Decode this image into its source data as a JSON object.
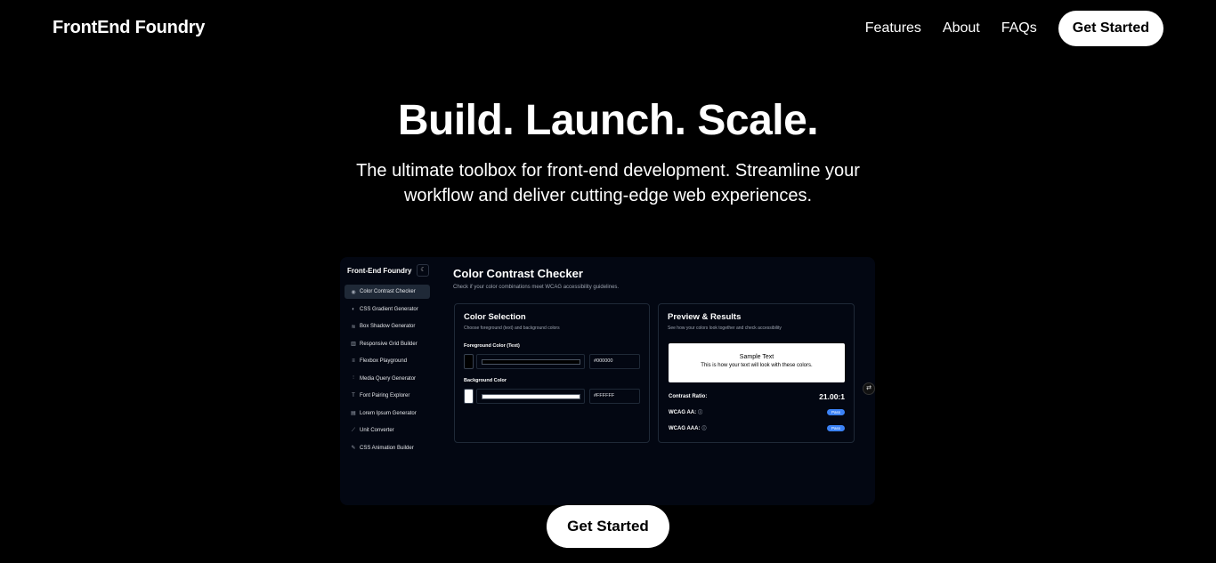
{
  "nav": {
    "brand": "FrontEnd Foundry",
    "links": [
      "Features",
      "About",
      "FAQs"
    ],
    "cta": "Get Started"
  },
  "hero": {
    "title": "Build. Launch. Scale.",
    "subtitle_line1": "The ultimate toolbox for front-end development. Streamline your",
    "subtitle_line2": "workflow and deliver cutting-edge web experiences."
  },
  "preview": {
    "brand": "Front-End Foundry",
    "theme_icon": "moon-icon",
    "sidebar": [
      {
        "label": "Color Contrast Checker",
        "icon": "eye-icon",
        "active": true
      },
      {
        "label": "CSS Gradient Generator",
        "icon": "palette-icon",
        "active": false
      },
      {
        "label": "Box Shadow Generator",
        "icon": "layers-icon",
        "active": false
      },
      {
        "label": "Responsive Grid Builder",
        "icon": "grid-icon",
        "active": false
      },
      {
        "label": "Flexbox Playground",
        "icon": "align-icon",
        "active": false
      },
      {
        "label": "Media Query Generator",
        "icon": "sliders-icon",
        "active": false
      },
      {
        "label": "Font Pairing Explorer",
        "icon": "type-icon",
        "active": false
      },
      {
        "label": "Lorem Ipsum Generator",
        "icon": "document-icon",
        "active": false
      },
      {
        "label": "Unit Converter",
        "icon": "ruler-icon",
        "active": false
      },
      {
        "label": "CSS Animation Builder",
        "icon": "pen-icon",
        "active": false
      }
    ],
    "main": {
      "title": "Color Contrast Checker",
      "description": "Check if your color combinations meet WCAG accessibility guidelines."
    },
    "selection": {
      "title": "Color Selection",
      "description": "Choose foreground (text) and background colors",
      "fg_label": "Foreground Color (Text)",
      "fg_value": "#000000",
      "bg_label": "Background Color",
      "bg_value": "#FFFFFF"
    },
    "results": {
      "title": "Preview & Results",
      "description": "See how your colors look together and check accessibility",
      "sample_title": "Sample Text",
      "sample_body": "This is how your text will look with these colors.",
      "ratio_label": "Contrast Ratio:",
      "ratio_value": "21.00:1",
      "aa_label": "WCAG AA:",
      "aa_status": "Pass",
      "aaa_label": "WCAG AAA:",
      "aaa_status": "Pass"
    }
  },
  "bottom_cta": "Get Started",
  "colors": {
    "background": "#000000",
    "preview_bg": "#030712",
    "accent": "#3b82f6"
  }
}
